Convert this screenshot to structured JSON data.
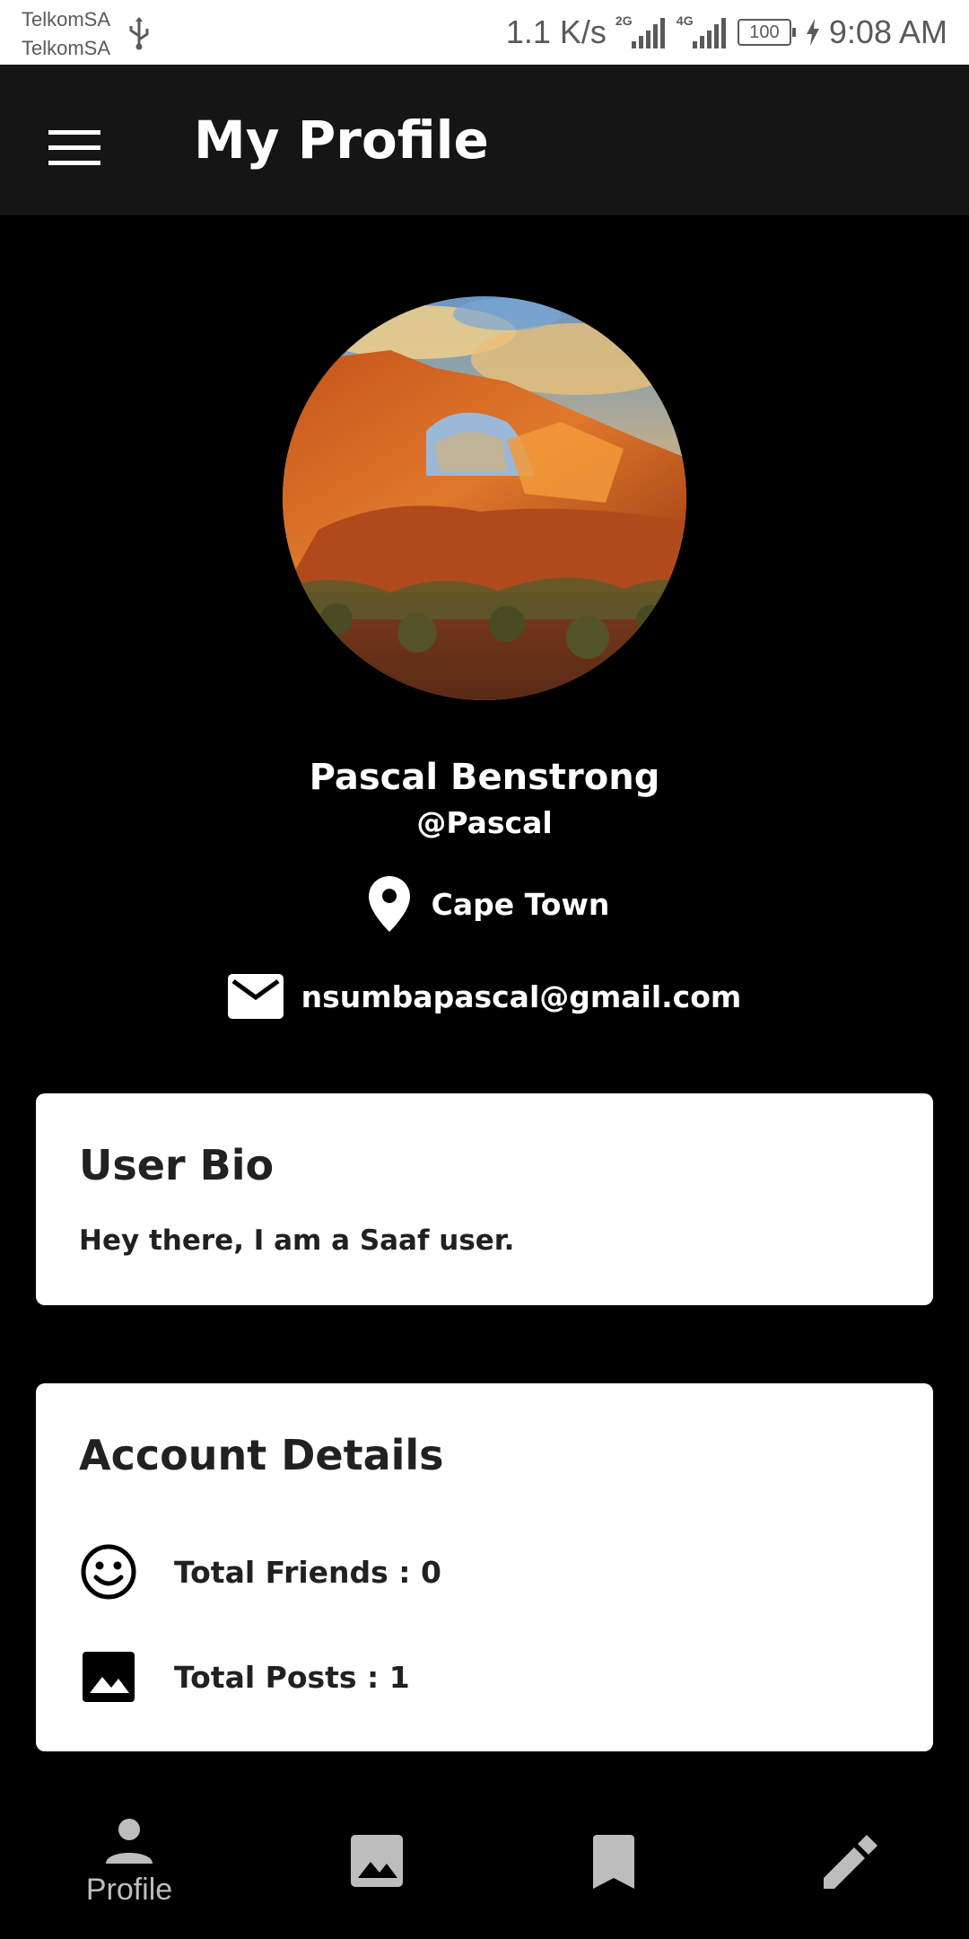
{
  "status_bar": {
    "carrier_1": "TelkomSA",
    "carrier_2": "TelkomSA",
    "net_speed": "1.1 K/s",
    "signal_1_label": "2G",
    "signal_2_label": "4G",
    "battery": "100",
    "time": "9:08 AM",
    "icons": [
      "usb-icon",
      "signal-icon",
      "battery-icon",
      "charging-bolt-icon"
    ]
  },
  "app_bar": {
    "title": "My Profile",
    "menu_icon": "hamburger-menu-icon"
  },
  "profile": {
    "name": "Pascal Benstrong",
    "handle": "@Pascal",
    "location": "Cape Town",
    "email": "nsumbapascal@gmail.com",
    "avatar_subject": "red rock arch at sunset"
  },
  "bio_card": {
    "title": "User Bio",
    "text": "Hey there, I am a Saaf user."
  },
  "account_card": {
    "title": "Account Details",
    "friends": "Total Friends : 0",
    "posts": "Total Posts : 1"
  },
  "bottom_nav": {
    "items": [
      {
        "label": "Profile",
        "icon": "person-icon",
        "active": true
      },
      {
        "label": "",
        "icon": "image-icon",
        "active": false
      },
      {
        "label": "",
        "icon": "bookmark-icon",
        "active": false
      },
      {
        "label": "",
        "icon": "pencil-icon",
        "active": false
      }
    ]
  },
  "colors": {
    "background": "#000000",
    "app_bar": "#151515",
    "card": "#ffffff",
    "card_text": "#212121",
    "nav_icon": "#bdbdbd"
  }
}
